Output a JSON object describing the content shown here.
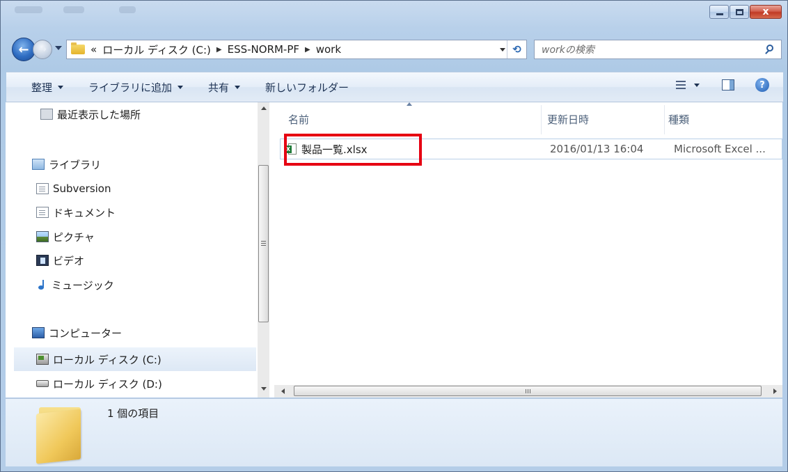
{
  "window": {
    "minimize_glyph": "",
    "maximize_glyph": "",
    "close_glyph": "x"
  },
  "nav": {
    "back_icon": "back-arrow-icon",
    "forward_icon": "forward-arrow-icon",
    "refresh_glyph": "⟲"
  },
  "address": {
    "overflow": "«",
    "crumbs": [
      "ローカル ディスク (C:)",
      "ESS-NORM-PF",
      "work"
    ]
  },
  "search": {
    "placeholder": "workの検索"
  },
  "toolbar": {
    "organize": "整理",
    "add_to_library": "ライブラリに追加",
    "share": "共有",
    "new_folder": "新しいフォルダー",
    "help_glyph": "?"
  },
  "sidebar": {
    "items": [
      {
        "label": "最近表示した場所",
        "icon": "recent-places-icon"
      },
      {
        "label": "ライブラリ",
        "icon": "library-icon"
      },
      {
        "label": "Subversion",
        "icon": "document-icon"
      },
      {
        "label": "ドキュメント",
        "icon": "document-icon"
      },
      {
        "label": "ピクチャ",
        "icon": "pictures-icon"
      },
      {
        "label": "ビデオ",
        "icon": "video-icon"
      },
      {
        "label": "ミュージック",
        "icon": "music-icon"
      },
      {
        "label": "コンピューター",
        "icon": "computer-icon"
      },
      {
        "label": "ローカル ディスク (C:)",
        "icon": "local-disk-icon",
        "selected": true
      },
      {
        "label": "ローカル ディスク (D:)",
        "icon": "drive-icon"
      }
    ]
  },
  "files": {
    "columns": [
      "名前",
      "更新日時",
      "種類"
    ],
    "rows": [
      {
        "name": "製品一覧.xlsx",
        "modified": "2016/01/13 16:04",
        "type": "Microsoft Excel ...",
        "icon": "excel-file-icon"
      }
    ],
    "highlight_color": "#e60012"
  },
  "details": {
    "item_count": "1 個の項目"
  },
  "colors": {
    "frame": "#b8d0ea",
    "accent": "#2f6dc2",
    "highlight": "#e60012"
  }
}
